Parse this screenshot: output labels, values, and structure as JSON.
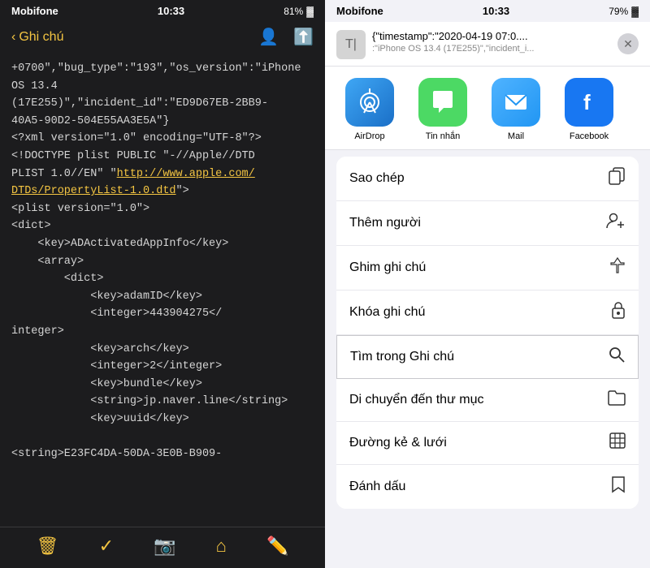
{
  "left": {
    "status": {
      "carrier": "Mobifone",
      "time": "10:33",
      "battery": "81%"
    },
    "nav": {
      "back_label": "Ghi chú"
    },
    "content_lines": [
      "+0700\",\"bug_type\":\"193\",\"os_version\":\"iPhone OS 13.4",
      "(17E255)\",\"incident_id\":\"ED9D67EB-2BB9-",
      "40A5-90D2-504E55AA3E5A\"}",
      "<?xml version=\"1.0\" encoding=\"UTF-8\"?>",
      "<!DOCTYPE plist PUBLIC \"-//Apple//DTD",
      "PLIST 1.0//EN\" \"",
      "DTDs/PropertyList-1.0.dtd\">",
      "<plist version=\"1.0\">",
      "<dict>",
      "    <key>ADActivatedAppInfo</key>",
      "    <array>",
      "        <dict>",
      "            <key>adamID</key>",
      "            <integer>443904275</integer>",
      "integer>",
      "            <key>arch</key>",
      "            <integer>2</integer>",
      "            <key>bundle</key>",
      "            <string>jp.naver.line</string>",
      "            <key>uuid</key>",
      "",
      "<string>E23FC4DA-50DA-3E0B-B909-"
    ],
    "link_text": "http://www.apple.com/",
    "bottom_icons": [
      "trash",
      "checkmark",
      "camera",
      "anchor",
      "pencil"
    ]
  },
  "right": {
    "status": {
      "carrier": "Mobifone",
      "time": "10:33",
      "battery": "79%"
    },
    "sheet": {
      "title": "{\"timestamp\":\"2020-04-19 07:0....",
      "subtitle": ":\"iPhone OS 13.4 (17E255)\",\"incident_i...",
      "close_label": "✕"
    },
    "share_apps": [
      {
        "id": "airdrop",
        "label": "AirDrop",
        "icon": "📡"
      },
      {
        "id": "messages",
        "label": "Tin nhắn",
        "icon": "💬"
      },
      {
        "id": "mail",
        "label": "Mail",
        "icon": "✉️"
      },
      {
        "id": "facebook",
        "label": "Facebook",
        "icon": "f"
      }
    ],
    "menu_items": [
      {
        "id": "sao-chep",
        "label": "Sao chép",
        "icon": "📋"
      },
      {
        "id": "them-nguoi",
        "label": "Thêm người",
        "icon": "👤➕"
      },
      {
        "id": "ghim-ghi-chu",
        "label": "Ghim ghi chú",
        "icon": "📌"
      },
      {
        "id": "khoa-ghi-chu",
        "label": "Khóa ghi chú",
        "icon": "🔒"
      },
      {
        "id": "tim-trong-ghi-chu",
        "label": "Tìm trong Ghi chú",
        "icon": "🔍",
        "highlighted": true
      },
      {
        "id": "di-chuyen-den-thu-muc",
        "label": "Di chuyển đến thư mục",
        "icon": "📁"
      },
      {
        "id": "duong-ke-luoi",
        "label": "Đường kẻ & lưới",
        "icon": "⊞"
      },
      {
        "id": "danh-dau",
        "label": "Đánh dấu",
        "icon": "🔖"
      }
    ]
  }
}
